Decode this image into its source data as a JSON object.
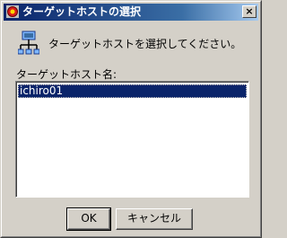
{
  "window": {
    "title": "ターゲットホストの選択",
    "close_label": "×",
    "title_icon": "app-icon",
    "titlebar_color": "#0a246a"
  },
  "content": {
    "message": "ターゲットホストを選択してください。",
    "icon": "network-host-icon",
    "list_label": "ターゲットホスト名:",
    "hosts": [
      "ichiro01"
    ],
    "selected_index": 0
  },
  "buttons": {
    "ok": "OK",
    "cancel": "キャンセル"
  }
}
